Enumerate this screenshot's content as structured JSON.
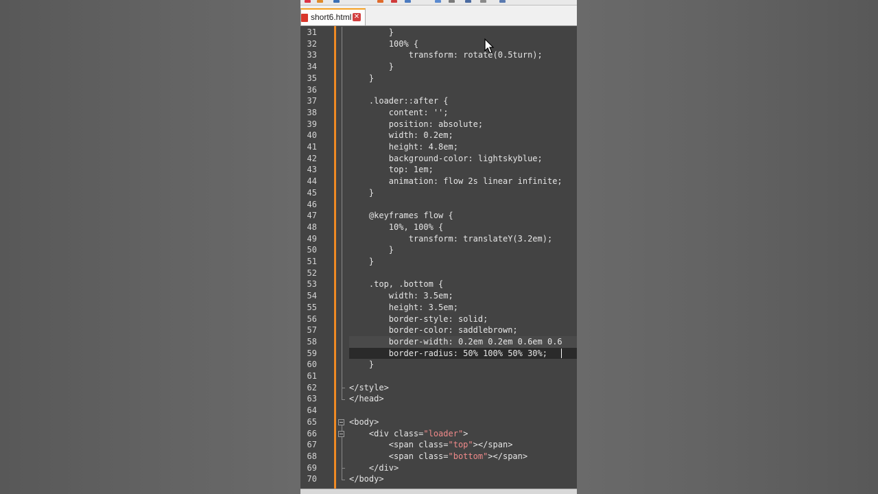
{
  "tab": {
    "file_name": "short6.html",
    "close_glyph": "✕"
  },
  "editor": {
    "lines": [
      {
        "n": "31",
        "text": "        }"
      },
      {
        "n": "32",
        "text": "        100% {"
      },
      {
        "n": "33",
        "text": "            transform: rotate(0.5turn);"
      },
      {
        "n": "34",
        "text": "        }"
      },
      {
        "n": "35",
        "text": "    }"
      },
      {
        "n": "36",
        "text": ""
      },
      {
        "n": "37",
        "text": "    .loader::after {"
      },
      {
        "n": "38",
        "text": "        content: '';"
      },
      {
        "n": "39",
        "text": "        position: absolute;"
      },
      {
        "n": "40",
        "text": "        width: 0.2em;"
      },
      {
        "n": "41",
        "text": "        height: 4.8em;"
      },
      {
        "n": "42",
        "text": "        background-color: lightskyblue;"
      },
      {
        "n": "43",
        "text": "        top: 1em;"
      },
      {
        "n": "44",
        "text": "        animation: flow 2s linear infinite;"
      },
      {
        "n": "45",
        "text": "    }"
      },
      {
        "n": "46",
        "text": ""
      },
      {
        "n": "47",
        "text": "    @keyframes flow {"
      },
      {
        "n": "48",
        "text": "        10%, 100% {"
      },
      {
        "n": "49",
        "text": "            transform: translateY(3.2em);"
      },
      {
        "n": "50",
        "text": "        }"
      },
      {
        "n": "51",
        "text": "    }"
      },
      {
        "n": "52",
        "text": ""
      },
      {
        "n": "53",
        "text": "    .top, .bottom {"
      },
      {
        "n": "54",
        "text": "        width: 3.5em;"
      },
      {
        "n": "55",
        "text": "        height: 3.5em;"
      },
      {
        "n": "56",
        "text": "        border-style: solid;"
      },
      {
        "n": "57",
        "text": "        border-color: saddlebrown;"
      },
      {
        "n": "58",
        "text": "        border-width: 0.2em 0.2em 0.6em 0.6"
      },
      {
        "n": "59",
        "text": "        border-radius: 50% 100% 50% 30%;"
      },
      {
        "n": "60",
        "text": "    }"
      },
      {
        "n": "61",
        "text": ""
      },
      {
        "n": "62",
        "text": "</style>"
      },
      {
        "n": "63",
        "text": "</head>"
      },
      {
        "n": "64",
        "text": ""
      },
      {
        "n": "65",
        "text": "<body>"
      },
      {
        "n": "66",
        "text": "    <div class=\"loader\">"
      },
      {
        "n": "67",
        "text": "        <span class=\"top\"></span>"
      },
      {
        "n": "68",
        "text": "        <span class=\"bottom\"></span>"
      },
      {
        "n": "69",
        "text": "    </div>"
      },
      {
        "n": "70",
        "text": "</body>"
      }
    ]
  },
  "colors": {
    "editor_bg": "#434343",
    "current_line": "#2a2a2a",
    "change_bar": "#f08a24",
    "tag": "#e6e6e6",
    "attr_value": "#f08a8a",
    "tab_accent": "#f6a020"
  },
  "icons": {
    "file": "html-file-icon",
    "close": "close-icon",
    "pointer": "mouse-pointer-icon"
  }
}
